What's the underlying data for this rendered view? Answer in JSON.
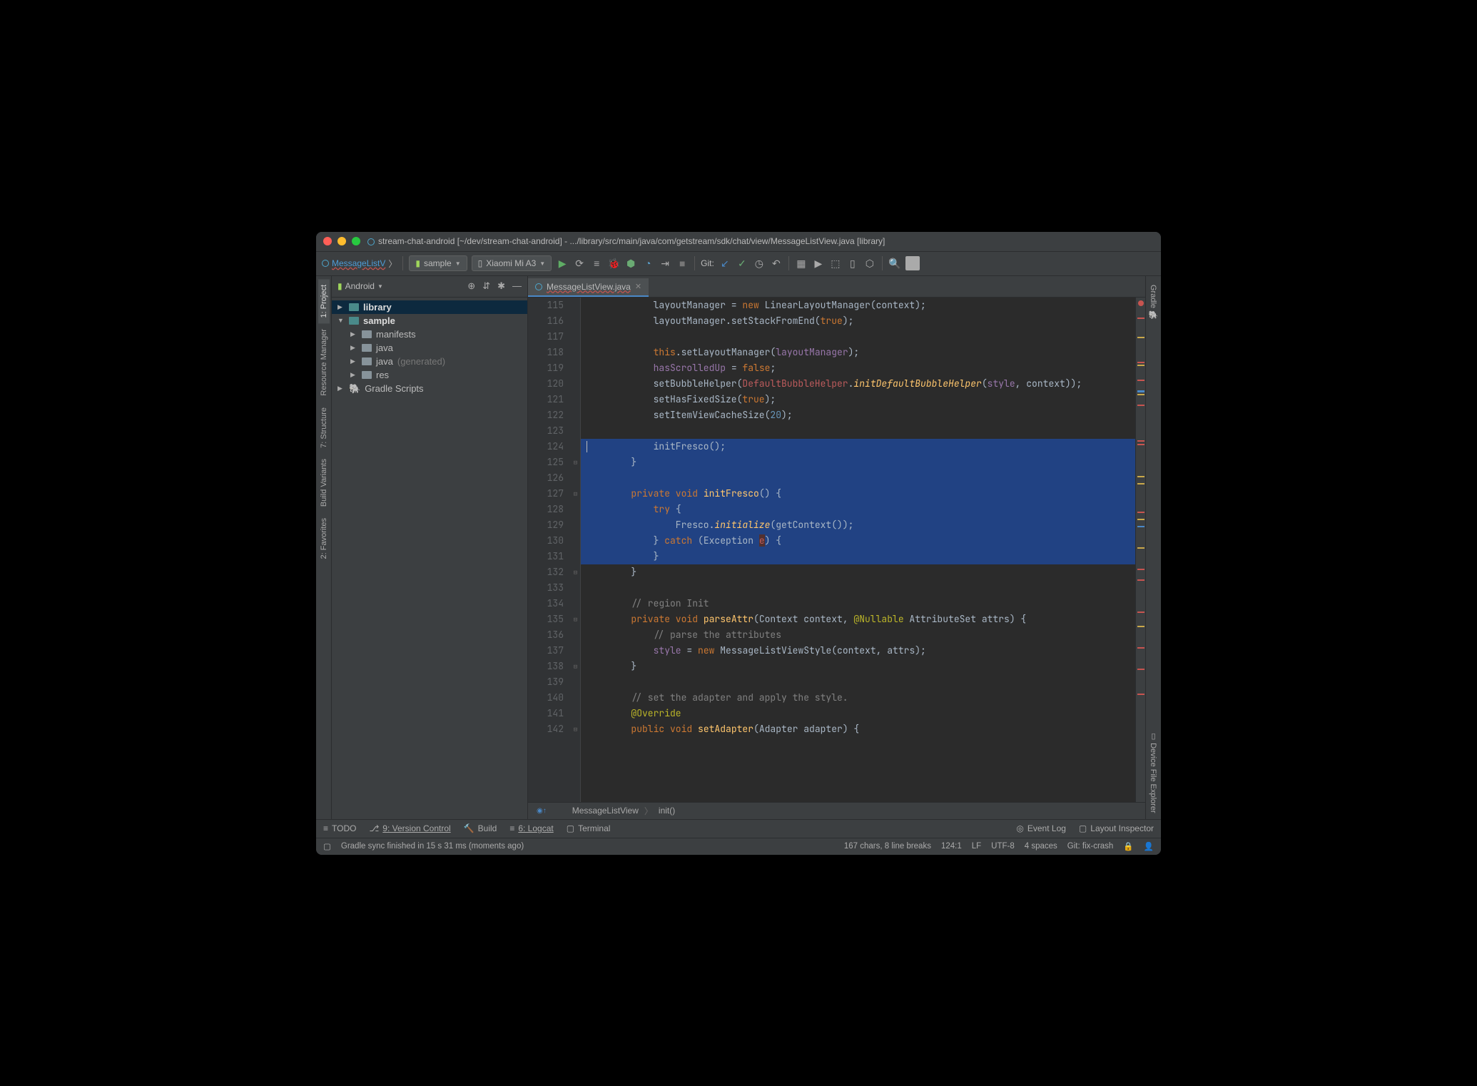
{
  "window": {
    "title": "stream-chat-android [~/dev/stream-chat-android] - .../library/src/main/java/com/getstream/sdk/chat/view/MessageListView.java [library]"
  },
  "toolbar": {
    "nav_link": "MessageListV",
    "run_config": "sample",
    "device": "Xiaomi Mi A3",
    "git_label": "Git:"
  },
  "sidebar": {
    "view_label": "Android",
    "tree": {
      "library": "library",
      "sample": "sample",
      "manifests": "manifests",
      "java": "java",
      "java_gen": "java",
      "java_gen_suffix": "(generated)",
      "res": "res",
      "gradle": "Gradle Scripts"
    }
  },
  "left_tabs": {
    "project": "1: Project",
    "resmgr": "Resource Manager",
    "structure": "7: Structure",
    "build_variants": "Build Variants",
    "favorites": "2: Favorites"
  },
  "right_tabs": {
    "gradle": "Gradle",
    "device_explorer": "Device File Explorer"
  },
  "editor": {
    "tab_name": "MessageListView.java",
    "crumb_class": "MessageListView",
    "crumb_method": "init()",
    "lines_start": 115,
    "lines_end": 142
  },
  "code": {
    "l115a": "            layoutManager = ",
    "l115b": "new",
    "l115c": " LinearLayoutManager(context);",
    "l116a": "            layoutManager.setStackFromEnd(",
    "l116b": "true",
    "l116c": ");",
    "l117": "",
    "l118a": "            ",
    "l118b": "this",
    "l118c": ".setLayoutManager(",
    "l118d": "layoutManager",
    "l118e": ");",
    "l119a": "            ",
    "l119b": "hasScrolledUp",
    "l119c": " = ",
    "l119d": "false",
    "l119e": ";",
    "l120a": "            setBubbleHelper(",
    "l120b": "DefaultBubbleHelper",
    "l120c": ".",
    "l120d": "initDefaultBubbleHelper",
    "l120e": "(",
    "l120f": "style",
    "l120g": ", context));",
    "l121a": "            setHasFixedSize(",
    "l121b": "true",
    "l121c": ");",
    "l122a": "            setItemViewCacheSize(",
    "l122b": "20",
    "l122c": ");",
    "l123": "",
    "l124a": "            initFresco();",
    "l125": "        }",
    "l126": "",
    "l127a": "        ",
    "l127b": "private void ",
    "l127c": "initFresco",
    "l127d": "() {",
    "l128a": "            ",
    "l128b": "try",
    "l128c": " {",
    "l129a": "                Fresco.",
    "l129b": "initialize",
    "l129c": "(getContext());",
    "l130a": "            } ",
    "l130b": "catch",
    "l130c": " (Exception ",
    "l130d": "e",
    "l130e": ") {",
    "l131": "            }",
    "l132": "        }",
    "l133": "",
    "l134a": "        ",
    "l134b": "// region Init",
    "l135a": "        ",
    "l135b": "private void ",
    "l135c": "parseAttr",
    "l135d": "(Context context, ",
    "l135e": "@Nullable",
    "l135f": " AttributeSet attrs) {",
    "l136a": "            ",
    "l136b": "// parse the attributes",
    "l137a": "            ",
    "l137b": "style",
    "l137c": " = ",
    "l137d": "new",
    "l137e": " MessageListViewStyle(context, attrs);",
    "l138": "        }",
    "l139": "",
    "l140a": "        ",
    "l140b": "// set the adapter and apply the style.",
    "l141a": "        ",
    "l141b": "@Override",
    "l142a": "        ",
    "l142b": "public void ",
    "l142c": "setAdapter",
    "l142d": "(Adapter adapter) {"
  },
  "bottombar": {
    "todo": "TODO",
    "vc": "9: Version Control",
    "build": "Build",
    "logcat": "6: Logcat",
    "terminal": "Terminal",
    "eventlog": "Event Log",
    "layout": "Layout Inspector"
  },
  "status": {
    "msg": "Gradle sync finished in 15 s 31 ms (moments ago)",
    "sel": "167 chars, 8 line breaks",
    "pos": "124:1",
    "le": "LF",
    "enc": "UTF-8",
    "indent": "4 spaces",
    "branch": "Git: fix-crash"
  }
}
